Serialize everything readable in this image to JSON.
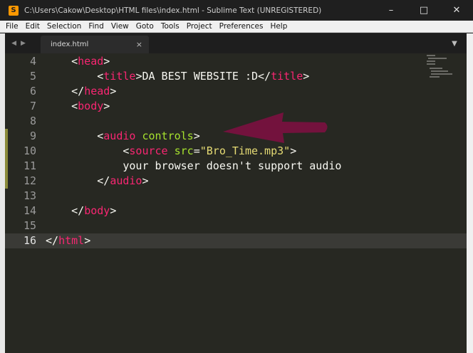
{
  "window": {
    "title": "C:\\Users\\Cakow\\Desktop\\HTML files\\index.html - Sublime Text (UNREGISTERED)",
    "app_icon_glyph": "S",
    "controls": [
      "minimize-icon",
      "maximize-icon",
      "close-icon"
    ]
  },
  "menu": [
    "File",
    "Edit",
    "Selection",
    "Find",
    "View",
    "Goto",
    "Tools",
    "Project",
    "Preferences",
    "Help"
  ],
  "tabs": [
    {
      "label": "index.html",
      "close_glyph": "×"
    }
  ],
  "colors": {
    "tag": "#f92672",
    "attribute": "#a6e22e",
    "string": "#e6db74",
    "text": "#f8f8f2",
    "editor_bg": "#272822",
    "annotation_arrow": "#7a1040"
  },
  "editor": {
    "active_line": 16,
    "modified_lines": [
      9,
      10,
      11,
      12
    ],
    "lines": [
      {
        "num": "4",
        "code": "    <head>"
      },
      {
        "num": "5",
        "code": "        <title>DA BEST WEBSITE :D</title>"
      },
      {
        "num": "6",
        "code": "    </head>"
      },
      {
        "num": "7",
        "code": "    <body>"
      },
      {
        "num": "8",
        "code": ""
      },
      {
        "num": "9",
        "code": "        <audio controls>"
      },
      {
        "num": "10",
        "code": "            <source src=\"Bro_Time.mp3\">"
      },
      {
        "num": "11",
        "code": "            your browser doesn't support audio"
      },
      {
        "num": "12",
        "code": "        </audio>"
      },
      {
        "num": "13",
        "code": ""
      },
      {
        "num": "14",
        "code": "    </body>"
      },
      {
        "num": "15",
        "code": ""
      },
      {
        "num": "16",
        "code": "</html>"
      }
    ]
  }
}
